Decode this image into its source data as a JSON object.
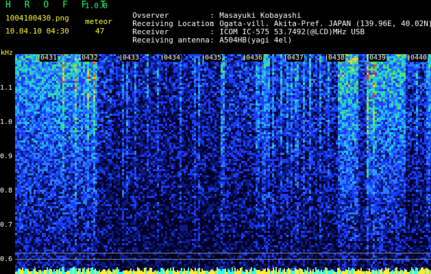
{
  "header": {
    "app_title": "H R O F F T",
    "app_version": "1.0.0",
    "filename": "1004100430.png",
    "datetime": "10.04.10 04:30",
    "meteor_label": "meteor",
    "meteor_count": "47"
  },
  "station_info": [
    {
      "key": "Ovserver",
      "value": "Masayuki Kobayashi"
    },
    {
      "key": "Receiving Location",
      "value": "Ogata-vill. Akita-Pref. JAPAN (139.96E, 40.02N)"
    },
    {
      "key": "Receiver",
      "value": "ICOM IC-575 53.7492(@LCD)MHz USB"
    },
    {
      "key": "Receiving antenna",
      "value": "A504HB(yagi 4el)"
    }
  ],
  "separator": ":",
  "spectrogram": {
    "y_unit": "kHz",
    "y_ticks": [
      "1.1",
      "1.0",
      "0.9",
      "0.8",
      "0.7",
      "0.6"
    ],
    "x_ticks": [
      "0431",
      "0432",
      "0433",
      "0434",
      "0435",
      "0436",
      "0437",
      "0438",
      "0439",
      "0440"
    ],
    "colors": {
      "low": "#000033",
      "mid": "#1a3cff",
      "high_green": "#33ff66",
      "peak": "#ff3300"
    }
  }
}
